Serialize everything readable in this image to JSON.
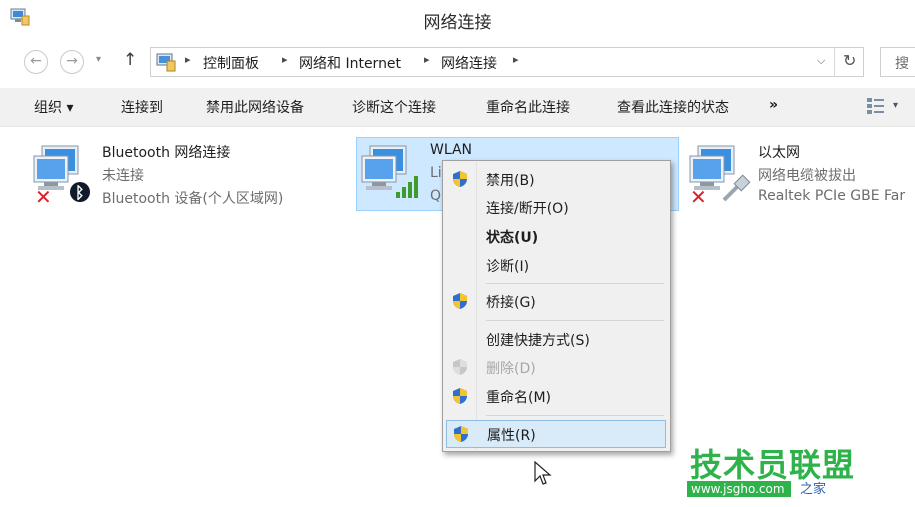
{
  "window": {
    "title": "网络连接"
  },
  "nav": {
    "back_icon": "arrow-left-icon",
    "forward_icon": "arrow-right-icon",
    "up_icon": "arrow-up-icon"
  },
  "address": {
    "crumbs": [
      "控制面板",
      "网络和 Internet",
      "网络连接"
    ],
    "refresh_icon": "refresh-icon",
    "search_placeholder": "搜"
  },
  "toolbar": {
    "organize": "组织 ▾",
    "connect": "连接到",
    "disable": "禁用此网络设备",
    "diagnose": "诊断这个连接",
    "rename": "重命名此连接",
    "view_status": "查看此连接的状态",
    "more": "»"
  },
  "connections": [
    {
      "name": "Bluetooth 网络连接",
      "status": "未连接",
      "device": "Bluetooth 设备(个人区域网)"
    },
    {
      "name": "WLAN",
      "status": "Li",
      "device": "Q"
    },
    {
      "name": "以太网",
      "status": "网络电缆被拔出",
      "device": "Realtek PCIe GBE Far"
    }
  ],
  "context_menu": {
    "items": [
      {
        "label": "禁用(B)",
        "shield": true
      },
      {
        "label": "连接/断开(O)",
        "shield": false
      },
      {
        "label": "状态(U)",
        "shield": false,
        "bold": true
      },
      {
        "label": "诊断(I)",
        "shield": false
      },
      {
        "label": "桥接(G)",
        "shield": true
      },
      {
        "label": "创建快捷方式(S)",
        "shield": false
      },
      {
        "label": "删除(D)",
        "shield": true,
        "disabled": true
      },
      {
        "label": "重命名(M)",
        "shield": true
      },
      {
        "label": "属性(R)",
        "shield": true,
        "highlighted": true
      }
    ]
  },
  "watermark": {
    "brand": "技术员联盟",
    "url": "www.jsgho.com",
    "suffix": "之家"
  },
  "colors": {
    "selection": "#cde8ff",
    "menu_bg": "#f0f0f0",
    "watermark_green": "#2db34a"
  }
}
